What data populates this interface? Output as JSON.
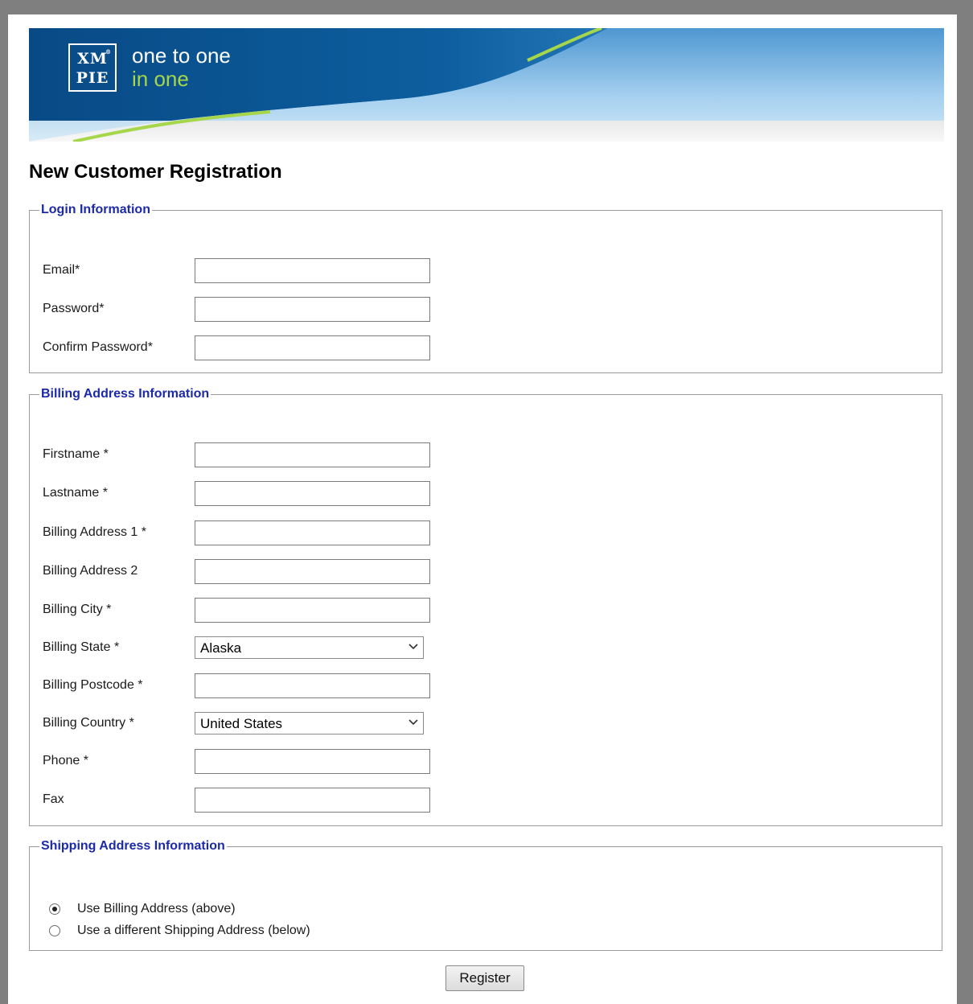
{
  "banner": {
    "logo_line1": "XM",
    "logo_line2": "PIE",
    "logo_reg": "®",
    "tagline_line1": "one to one",
    "tagline_line2": "in one"
  },
  "page_title": "New Customer Registration",
  "login_section": {
    "legend": "Login Information",
    "fields": [
      {
        "label": "Email*",
        "value": ""
      },
      {
        "label": "Password*",
        "value": ""
      },
      {
        "label": "Confirm Password*",
        "value": ""
      }
    ]
  },
  "billing_section": {
    "legend": "Billing Address Information",
    "fields": [
      {
        "label": "Firstname *",
        "value": ""
      },
      {
        "label": "Lastname *",
        "value": ""
      },
      {
        "label": "Billing Address 1 *",
        "value": ""
      },
      {
        "label": "Billing Address 2",
        "value": ""
      },
      {
        "label": "Billing City *",
        "value": ""
      },
      {
        "label": "Billing State *",
        "selected": "Alaska"
      },
      {
        "label": "Billing Postcode *",
        "value": ""
      },
      {
        "label": "Billing Country *",
        "selected": "United States"
      },
      {
        "label": "Phone *",
        "value": ""
      },
      {
        "label": "Fax",
        "value": ""
      }
    ]
  },
  "shipping_section": {
    "legend": "Shipping Address Information",
    "options": [
      {
        "label": "Use Billing Address (above)",
        "checked": true
      },
      {
        "label": "Use a different Shipping Address (below)",
        "checked": false
      }
    ]
  },
  "register_label": "Register",
  "colors": {
    "legend": "#1d2aa8",
    "banner_dark": "#0a4e8c",
    "banner_light": "#bfe0f4",
    "tagline_green": "#a6d64a",
    "frame": "#7f7f7f"
  }
}
